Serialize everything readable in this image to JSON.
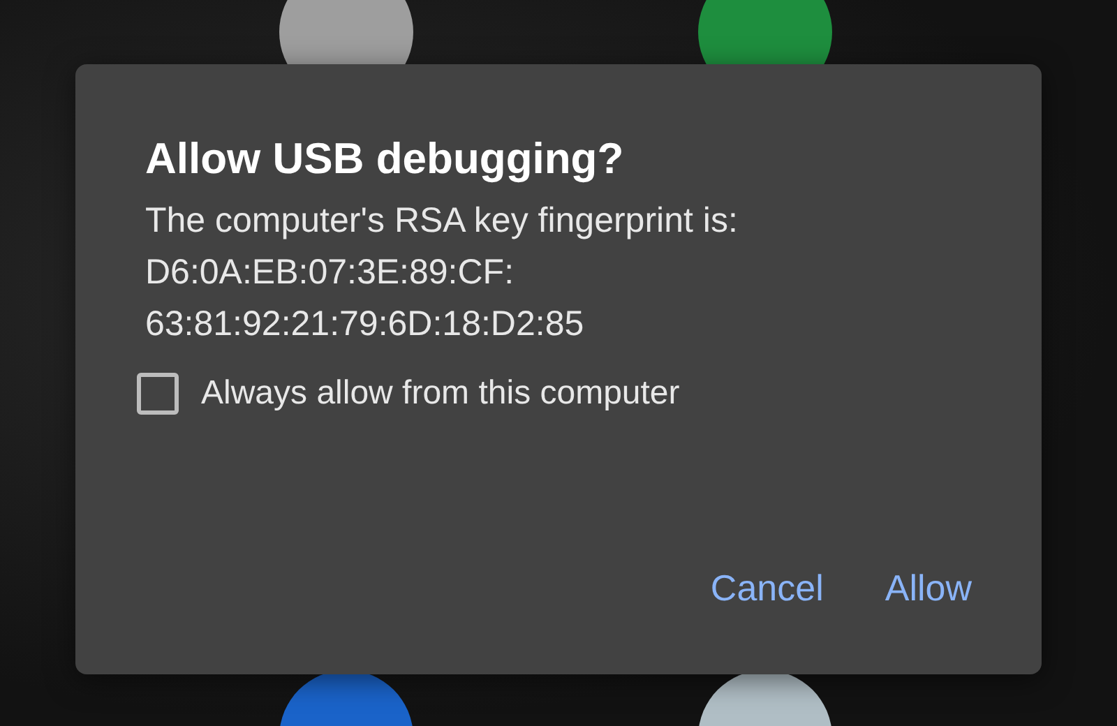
{
  "dialog": {
    "title": "Allow USB debugging?",
    "message": "The computer's RSA key fingerprint is:",
    "fingerprint_lines": [
      "D6:0A:EB:07:3E:89:CF:",
      "63:81:92:21:79:6D:18:D2:85"
    ],
    "checkbox": {
      "label": "Always allow from this computer",
      "checked": false
    },
    "buttons": [
      "Cancel",
      "Allow"
    ]
  }
}
